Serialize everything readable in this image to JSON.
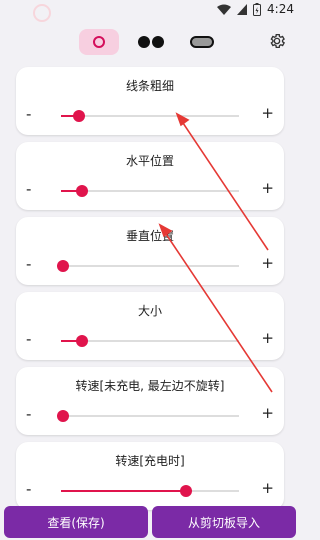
{
  "status": {
    "time": "4:24"
  },
  "modes": [
    {
      "icon": "circle-ring-icon",
      "selected": true
    },
    {
      "icon": "two-dots-icon",
      "selected": false
    },
    {
      "icon": "pill-icon",
      "selected": false
    }
  ],
  "sliders": [
    {
      "title": "线条粗细",
      "value": 0.1
    },
    {
      "title": "水平位置",
      "value": 0.12
    },
    {
      "title": "垂直位置",
      "value": 0.01
    },
    {
      "title": "大小",
      "value": 0.12
    },
    {
      "title": "转速[未充电, 最左边不旋转]",
      "value": 0.01
    },
    {
      "title": "转速[充电时]",
      "value": 0.7
    }
  ],
  "labels": {
    "minus": "-",
    "plus": "+"
  },
  "buttons": {
    "view_save": "查看(保存)",
    "import_clipboard": "从剪切板导入"
  },
  "colors": {
    "accent": "#e0144c",
    "button": "#7b2aa6",
    "selected_mode": "#f7cfe0",
    "arrow": "#e53935"
  }
}
